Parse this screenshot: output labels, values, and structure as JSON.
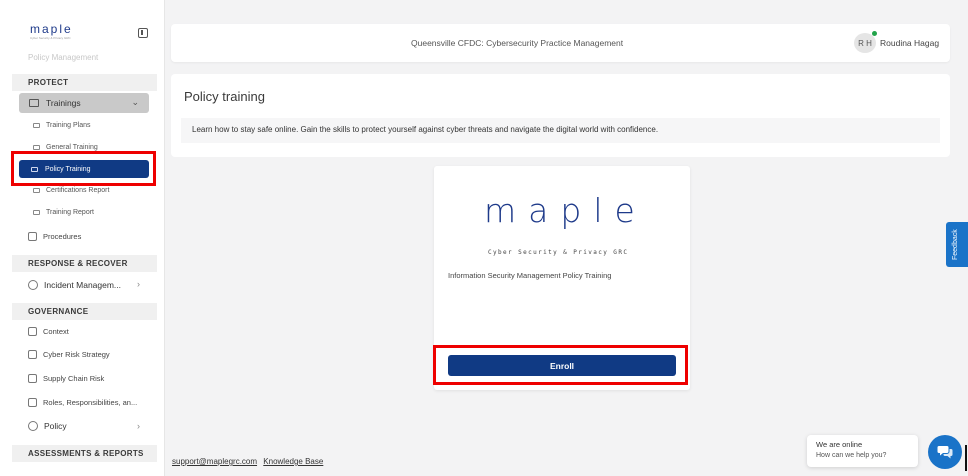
{
  "sidebar": {
    "logo": "maple",
    "logo_sub": "Cyber Security & Privacy GRC",
    "faded_item": "Policy Management",
    "sections": {
      "protect": "PROTECT",
      "response": "RESPONSE & RECOVER",
      "governance": "GOVERNANCE",
      "assessments": "ASSESSMENTS & REPORTS"
    },
    "trainings_label": "Trainings",
    "sub_items": {
      "training_plans": "Training Plans",
      "general_training": "General Training",
      "policy_training": "Policy Training",
      "certifications_report": "Certifications Report",
      "training_report": "Training Report"
    },
    "procedures": "Procedures",
    "incident_management": "Incident Managem...",
    "context": "Context",
    "cyber_risk_strategy": "Cyber Risk Strategy",
    "supply_chain_risk": "Supply Chain Risk",
    "roles": "Roles, Responsibilities, an...",
    "policy": "Policy"
  },
  "header": {
    "title": "Queensville CFDC: Cybersecurity Practice Management",
    "avatar_initials": "R H",
    "user_name": "Roudina Hagag"
  },
  "page": {
    "title": "Policy training",
    "description": "Learn how to stay safe online. Gain the skills to protect yourself against cyber threats and navigate the digital world with confidence."
  },
  "course": {
    "logo": "maple",
    "logo_sub": "Cyber Security & Privacy GRC",
    "name": "Information Security Management Policy Training",
    "enroll_label": "Enroll"
  },
  "footer": {
    "support_email": "support@maplegrc.com",
    "knowledge_base": "Knowledge Base"
  },
  "feedback_label": "Feedback",
  "chat": {
    "title": "We are online",
    "subtitle": "How can we help you?"
  },
  "colors": {
    "primary": "#103a84",
    "highlight": "#e00000",
    "feedback": "#1a73c8"
  }
}
